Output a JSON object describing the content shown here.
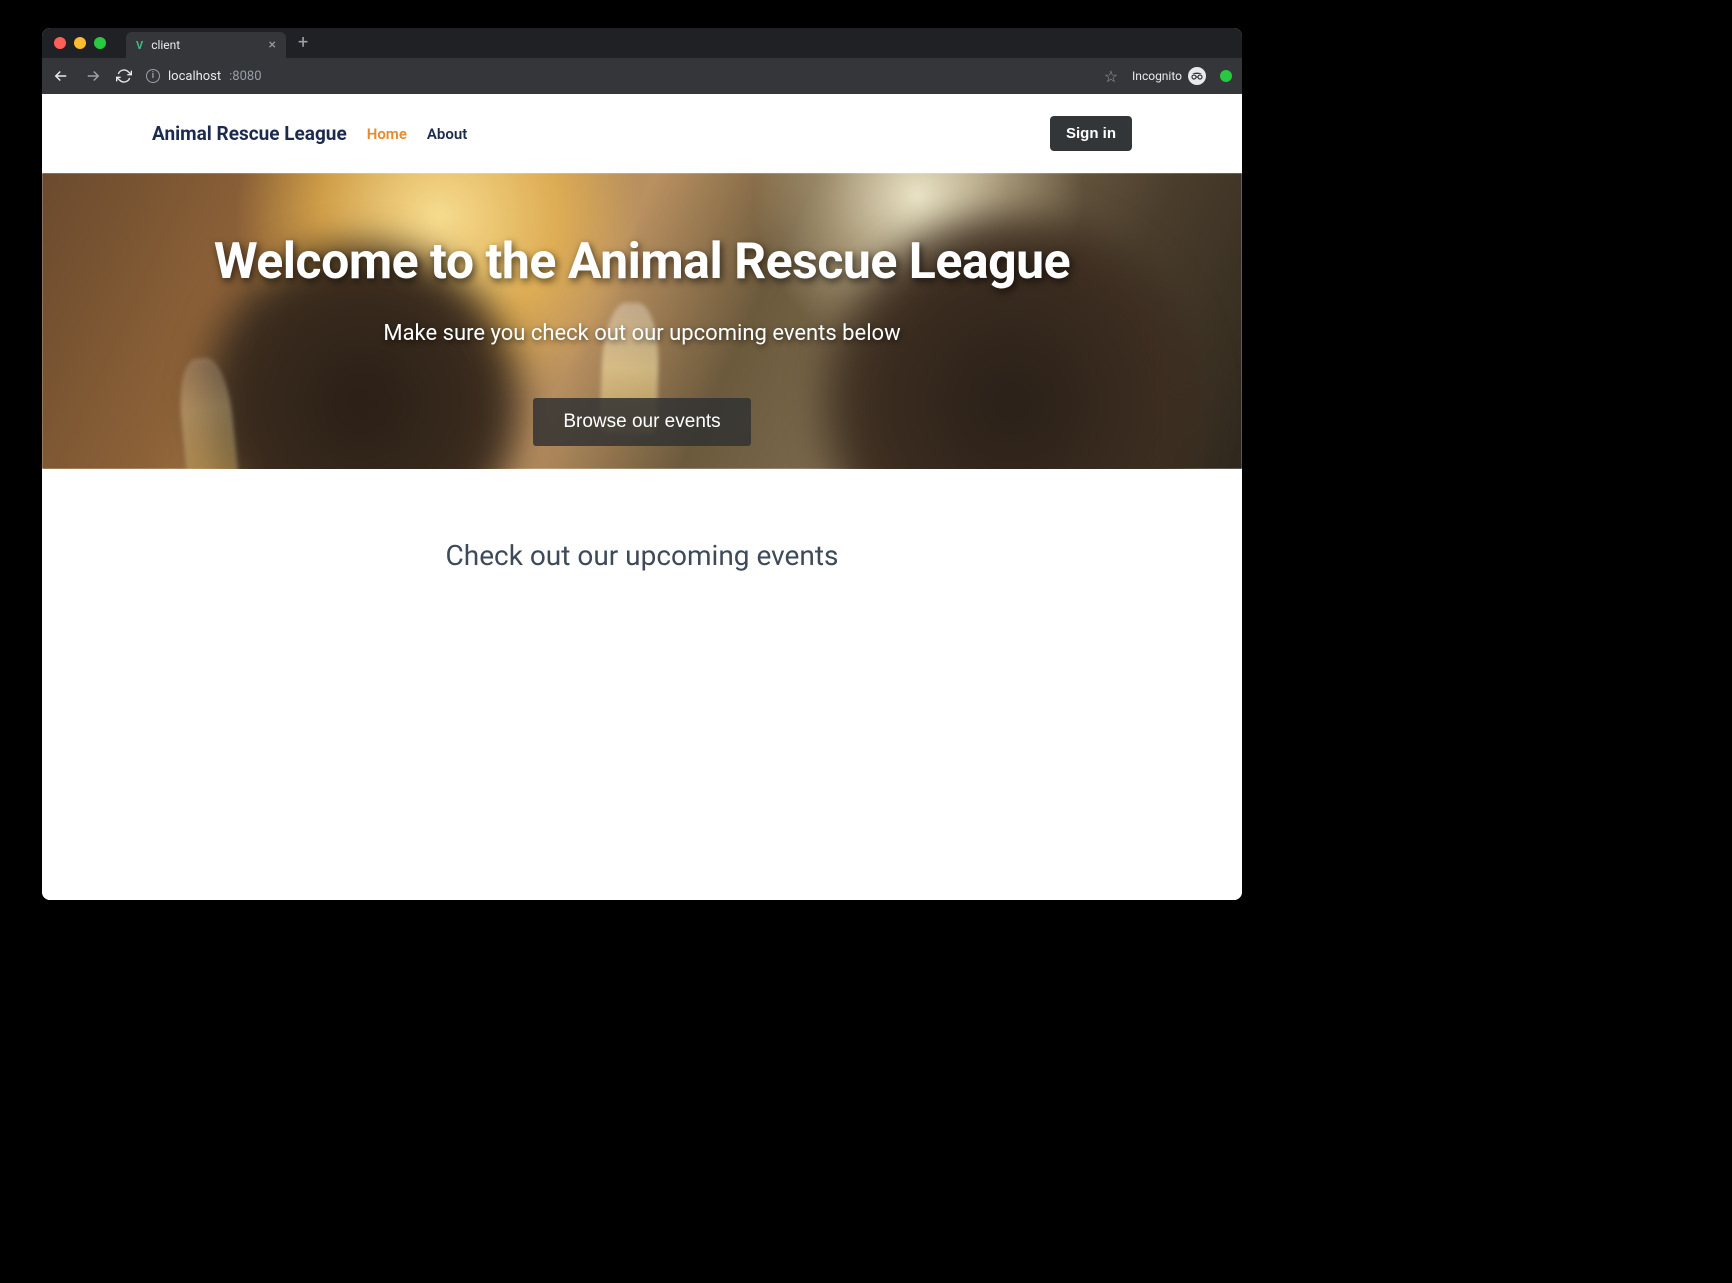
{
  "browser": {
    "tab_title": "client",
    "url_host": "localhost",
    "url_port": ":8080",
    "incognito_label": "Incognito"
  },
  "nav": {
    "brand": "Animal Rescue League",
    "home": "Home",
    "about": "About",
    "signin": "Sign in"
  },
  "hero": {
    "title": "Welcome to the Animal Rescue League",
    "subtitle": "Make sure you check out our upcoming events below",
    "cta": "Browse our events"
  },
  "events": {
    "heading": "Check out our upcoming events"
  }
}
